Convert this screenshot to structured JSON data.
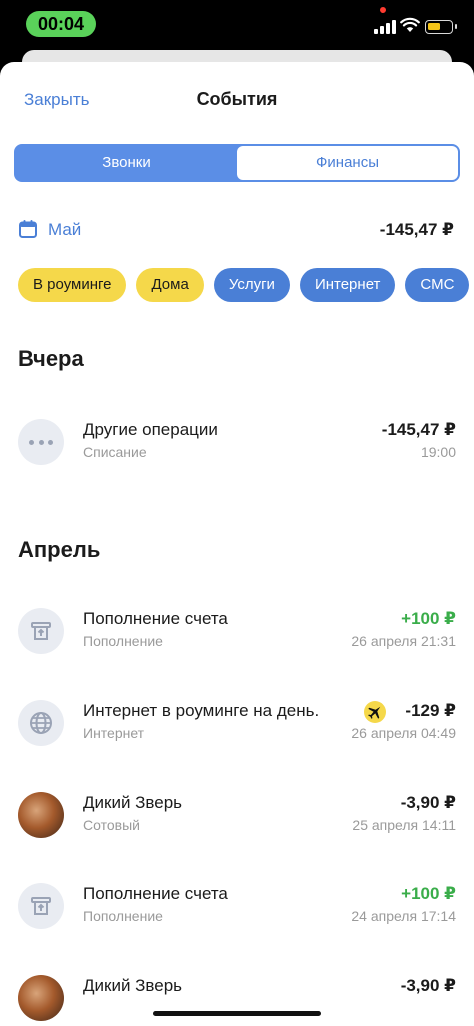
{
  "status": {
    "time": "00:04"
  },
  "header": {
    "close_label": "Закрыть",
    "title": "События"
  },
  "tabs": [
    {
      "label": "Звонки"
    },
    {
      "label": "Финансы"
    }
  ],
  "month": {
    "label": "Май",
    "total": "-145,47 ₽"
  },
  "chips": [
    {
      "label": "В роуминге",
      "color": "#f5d84a"
    },
    {
      "label": "Дома",
      "color": "#f5d84a"
    },
    {
      "label": "Услуги",
      "color": "#4a7fd6"
    },
    {
      "label": "Интернет",
      "color": "#4a7fd6"
    },
    {
      "label": "СМС",
      "color": "#4a7fd6"
    }
  ],
  "sections": [
    {
      "title": "Вчера",
      "items": [
        {
          "title": "Другие операции",
          "subtitle": "Списание",
          "amount": "-145,47 ₽",
          "time": "19:00",
          "icon": "more-dots-icon"
        }
      ]
    },
    {
      "title": "Апрель",
      "items": [
        {
          "title": "Пополнение счета",
          "subtitle": "Пополнение",
          "amount": "+100 ₽",
          "time": "26 апреля 21:31",
          "icon": "atm-icon"
        },
        {
          "title": "Интернет в роуминге на день.",
          "subtitle": "Интернет",
          "amount": "-129 ₽",
          "time": "26 апреля 04:49",
          "icon": "globe-icon"
        },
        {
          "title": "Дикий Зверь",
          "subtitle": "Сотовый",
          "amount": "-3,90 ₽",
          "time": "25 апреля 14:11",
          "icon": "contact-photo"
        },
        {
          "title": "Пополнение счета",
          "subtitle": "Пополнение",
          "amount": "+100 ₽",
          "time": "24 апреля 17:14",
          "icon": "atm-icon"
        },
        {
          "title": "Дикий Зверь",
          "subtitle": "",
          "amount": "-3,90 ₽",
          "time": "",
          "icon": "contact-photo"
        }
      ]
    }
  ],
  "colors": {
    "accent": "#4a7fd6",
    "income": "#3aad4a",
    "roaming": "#f5d84a"
  }
}
